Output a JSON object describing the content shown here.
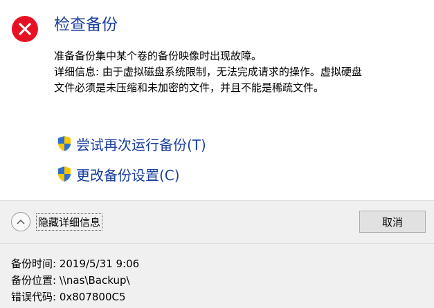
{
  "dialog": {
    "title": "检查备份",
    "icon": "error-icon",
    "accent_color": "#1a3e9e",
    "error_color": "#e81123"
  },
  "message": {
    "line1": "准备备份集中某个卷的备份映像时出现故障。",
    "line2": "详细信息: 由于虚拟磁盘系统限制，无法完成请求的操作。虚拟硬盘",
    "line3": "文件必须是未压缩和未加密的文件，并且不能是稀疏文件。"
  },
  "commands": {
    "retry": {
      "label": "尝试再次运行备份(T)",
      "icon": "uac-shield-icon"
    },
    "settings": {
      "label": "更改备份设置(C)",
      "icon": "uac-shield-icon"
    }
  },
  "footer": {
    "toggle_label": "隐藏详细信息",
    "toggle_icon": "chevron-up-icon",
    "close_label": "取消"
  },
  "details": {
    "time": "备份时间: 2019/5/31 9:06",
    "location": "备份位置: \\\\nas\\Backup\\",
    "error_code": "错误代码: 0x807800C5"
  }
}
